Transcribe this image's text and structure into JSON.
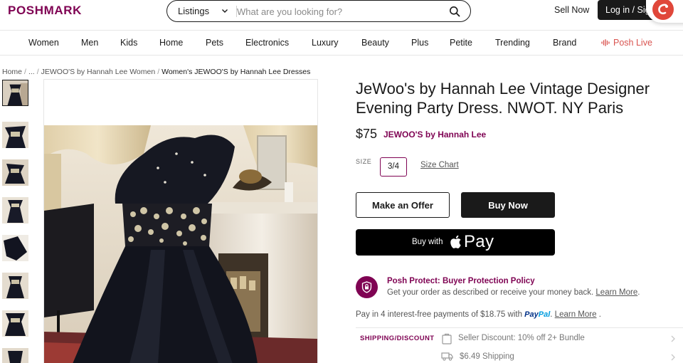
{
  "header": {
    "logo": "POSHMARK",
    "search_scope": "Listings",
    "search_placeholder": "What are you looking for?",
    "sell_now": "Sell Now",
    "login": "Log in / Sign Up"
  },
  "nav": {
    "items": [
      "Women",
      "Men",
      "Kids",
      "Home",
      "Pets",
      "Electronics",
      "Luxury",
      "Beauty",
      "Plus",
      "Petite",
      "Trending",
      "Brand"
    ],
    "live": "Posh Live"
  },
  "breadcrumb": {
    "items": [
      "Home",
      "...",
      "JEWOO'S by Hannah Lee Women"
    ],
    "current": "Women's JEWOO'S by Hannah Lee Dresses"
  },
  "product": {
    "title": "JeWoo's by Hannah Lee Vintage Designer Evening Party Dress. NWOT. NY Paris",
    "price": "$75",
    "brand": "JEWOO'S by Hannah Lee",
    "size_label": "SIZE",
    "size_value": "3/4",
    "size_chart": "Size Chart"
  },
  "actions": {
    "offer": "Make an Offer",
    "buy": "Buy Now",
    "applepay_prefix": "Buy with",
    "applepay_word": "Pay"
  },
  "protect": {
    "title": "Posh Protect: Buyer Protection Policy",
    "desc": "Get your order as described or receive your money back.",
    "link": "Learn More"
  },
  "installments": {
    "text": "Pay in 4 interest-free payments of $18.75 with",
    "paypal_pay": "Pay",
    "paypal_pal": "Pal",
    "link": "Learn More"
  },
  "shipping": {
    "label": "SHIPPING/DISCOUNT",
    "discount": "Seller Discount: 10% off 2+ Bundle",
    "shipping": "$6.49 Shipping"
  },
  "colors": {
    "brand": "#7f0353",
    "live": "#d9534f",
    "dark": "#1a1a1a"
  },
  "icons": [
    "chevron-down-icon",
    "search-icon",
    "chat-icon",
    "live-wave-icon",
    "apple-icon",
    "shield-lock-icon",
    "tag-icon",
    "truck-icon",
    "chevron-right-icon"
  ]
}
